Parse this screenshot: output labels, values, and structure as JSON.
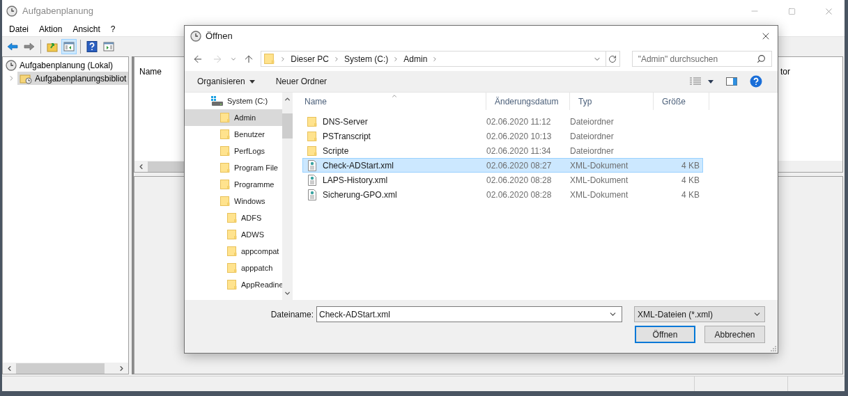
{
  "window": {
    "title": "Aufgabenplanung"
  },
  "menu": [
    "Datei",
    "Aktion",
    "Ansicht",
    "?"
  ],
  "toolbar": [
    [
      {
        "kind": "back",
        "selected": false
      },
      {
        "kind": "forward",
        "selected": false
      }
    ],
    [
      {
        "kind": "folder-up",
        "selected": false
      },
      {
        "kind": "tree-pane",
        "selected": true
      }
    ],
    [
      {
        "kind": "help",
        "selected": false
      },
      {
        "kind": "action-pane",
        "selected": false
      }
    ]
  ],
  "tree": [
    {
      "label": "Aufgabenplanung (Lokal)",
      "selected": false,
      "children": [
        {
          "label": "Aufgabenplanungsbibliot",
          "selected": true,
          "expanded": false
        }
      ]
    }
  ],
  "list": {
    "columns": [
      "Name",
      "tor"
    ]
  },
  "dialog": {
    "title": "Öffnen",
    "history": {
      "back_enabled": true,
      "forward_enabled": false
    },
    "breadcrumb": [
      "Dieser PC",
      "System (C:)",
      "Admin"
    ],
    "search": {
      "placeholder": "\"Admin\" durchsuchen"
    },
    "commands": [
      {
        "label": "Organisieren",
        "dropdown": true
      },
      {
        "label": "Neuer Ordner",
        "dropdown": false
      }
    ],
    "nav": [
      {
        "label": "System (C:)",
        "kind": "drive",
        "selected": false,
        "children": [
          {
            "label": "Admin",
            "kind": "folder",
            "selected": true
          },
          {
            "label": "Benutzer",
            "kind": "folder",
            "selected": false
          },
          {
            "label": "PerfLogs",
            "kind": "folder",
            "selected": false
          },
          {
            "label": "Program File",
            "kind": "folder",
            "selected": false
          },
          {
            "label": "Programme",
            "kind": "folder",
            "selected": false
          },
          {
            "label": "Windows",
            "kind": "folder",
            "selected": false,
            "children": [
              {
                "label": "ADFS",
                "kind": "folder",
                "selected": false
              },
              {
                "label": "ADWS",
                "kind": "folder",
                "selected": false
              },
              {
                "label": "appcompat",
                "kind": "folder",
                "selected": false
              },
              {
                "label": "apppatch",
                "kind": "folder",
                "selected": false
              },
              {
                "label": "AppReadine",
                "kind": "folder",
                "selected": false
              }
            ]
          }
        ]
      }
    ],
    "columns": [
      "Name",
      "Änderungsdatum",
      "Typ",
      "Größe"
    ],
    "files": [
      {
        "name": "DNS-Server",
        "date": "02.06.2020 11:12",
        "type": "Dateiordner",
        "kind": "folder",
        "selected": false
      },
      {
        "name": "PSTranscript",
        "date": "02.06.2020 10:13",
        "type": "Dateiordner",
        "kind": "folder",
        "selected": false
      },
      {
        "name": "Scripte",
        "date": "02.06.2020 11:34",
        "type": "Dateiordner",
        "kind": "folder",
        "selected": false
      },
      {
        "name": "Check-ADStart.xml",
        "date": "02.06.2020 08:27",
        "type": "XML-Dokument",
        "size": "4 KB",
        "kind": "xml",
        "selected": true
      },
      {
        "name": "LAPS-History.xml",
        "date": "02.06.2020 08:28",
        "type": "XML-Dokument",
        "size": "4 KB",
        "kind": "xml",
        "selected": false
      },
      {
        "name": "Sicherung-GPO.xml",
        "date": "02.06.2020 08:28",
        "type": "XML-Dokument",
        "size": "4 KB",
        "kind": "xml",
        "selected": false
      }
    ],
    "filename": {
      "label": "Dateiname:",
      "value": "Check-ADStart.xml"
    },
    "filter": "XML-Dateien (*.xml)",
    "buttons": [
      {
        "label": "Öffnen",
        "default": true
      },
      {
        "label": "Abbrechen",
        "default": false
      }
    ]
  }
}
